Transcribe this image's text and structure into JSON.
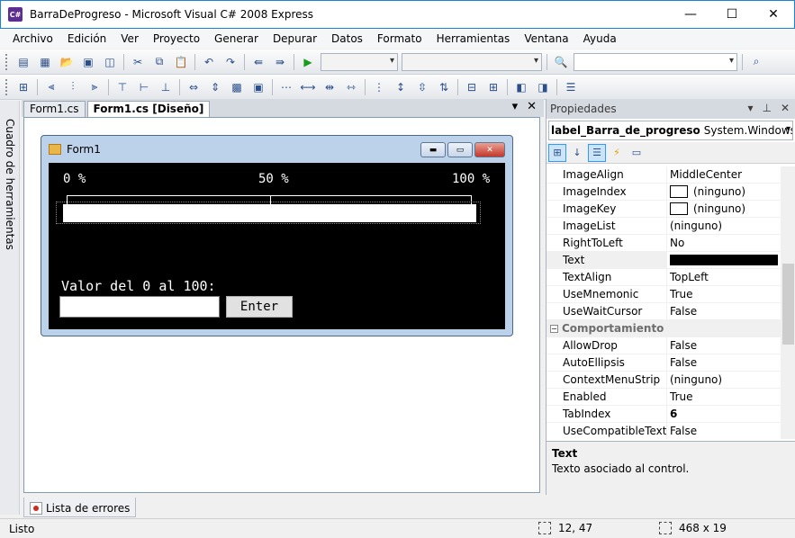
{
  "window": {
    "title": "BarraDeProgreso - Microsoft Visual C# 2008 Express",
    "minimize": "—",
    "maximize": "☐",
    "close": "✕"
  },
  "menu": [
    "Archivo",
    "Edición",
    "Ver",
    "Proyecto",
    "Generar",
    "Depurar",
    "Datos",
    "Formato",
    "Herramientas",
    "Ventana",
    "Ayuda"
  ],
  "toolbox": {
    "label": "Cuadro de herramientas"
  },
  "doc_tabs": {
    "tab1": "Form1.cs",
    "tab2": "Form1.cs [Diseño]",
    "dropdown": "▾",
    "close": "✕"
  },
  "form": {
    "title": "Form1",
    "label_0": "0 %",
    "label_50": "50 %",
    "label_100": "100 %",
    "label_valor": "Valor del 0 al 100:",
    "enter_button": "Enter",
    "min_btn": "▬",
    "max_btn": "▭",
    "close_btn": "✕"
  },
  "error_list": {
    "label": "Lista de errores"
  },
  "properties": {
    "header": "Propiedades",
    "object_name": "label_Barra_de_progreso",
    "object_type": "System.Windows.Forms.Label",
    "rows": [
      {
        "name": "ImageAlign",
        "value": "MiddleCenter"
      },
      {
        "name": "ImageIndex",
        "value": "(ninguno)",
        "swatch": true
      },
      {
        "name": "ImageKey",
        "value": "(ninguno)",
        "swatch": true
      },
      {
        "name": "ImageList",
        "value": "(ninguno)"
      },
      {
        "name": "RightToLeft",
        "value": "No"
      },
      {
        "name": "Text",
        "value": "",
        "black": true,
        "selected": true
      },
      {
        "name": "TextAlign",
        "value": "TopLeft"
      },
      {
        "name": "UseMnemonic",
        "value": "True"
      },
      {
        "name": "UseWaitCursor",
        "value": "False"
      },
      {
        "name": "Comportamiento",
        "category": true
      },
      {
        "name": "AllowDrop",
        "value": "False"
      },
      {
        "name": "AutoEllipsis",
        "value": "False"
      },
      {
        "name": "ContextMenuStrip",
        "value": "(ninguno)"
      },
      {
        "name": "Enabled",
        "value": "True"
      },
      {
        "name": "TabIndex",
        "value": "6",
        "bold": true
      },
      {
        "name": "UseCompatibleTextRendering",
        "value": "False"
      }
    ],
    "desc_title": "Text",
    "desc_text": "Texto asociado al control."
  },
  "status": {
    "text": "Listo",
    "position": "12, 47",
    "size": "468 x 19"
  }
}
